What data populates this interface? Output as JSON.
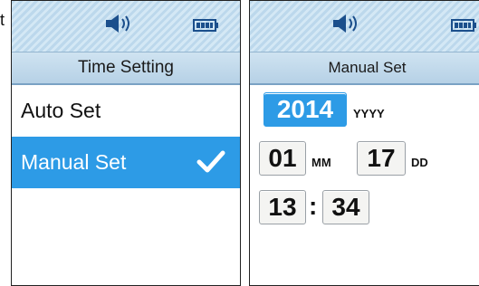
{
  "edge_text": "t",
  "left_screen": {
    "title": "Time Setting",
    "items": [
      {
        "label": "Auto Set",
        "selected": false
      },
      {
        "label": "Manual Set",
        "selected": true
      }
    ]
  },
  "right_screen": {
    "title": "Manual Set",
    "year": {
      "value": "2014",
      "unit": "YYYY"
    },
    "month": {
      "value": "01",
      "unit": "MM"
    },
    "day": {
      "value": "17",
      "unit": "DD"
    },
    "hour": "13",
    "separator": ":",
    "minute": "34"
  },
  "icons": {
    "speaker": "speaker-icon",
    "battery": "battery-icon",
    "check": "check-icon"
  },
  "colors": {
    "accent": "#2d9be6",
    "status_bg": "#c8e0f0"
  }
}
